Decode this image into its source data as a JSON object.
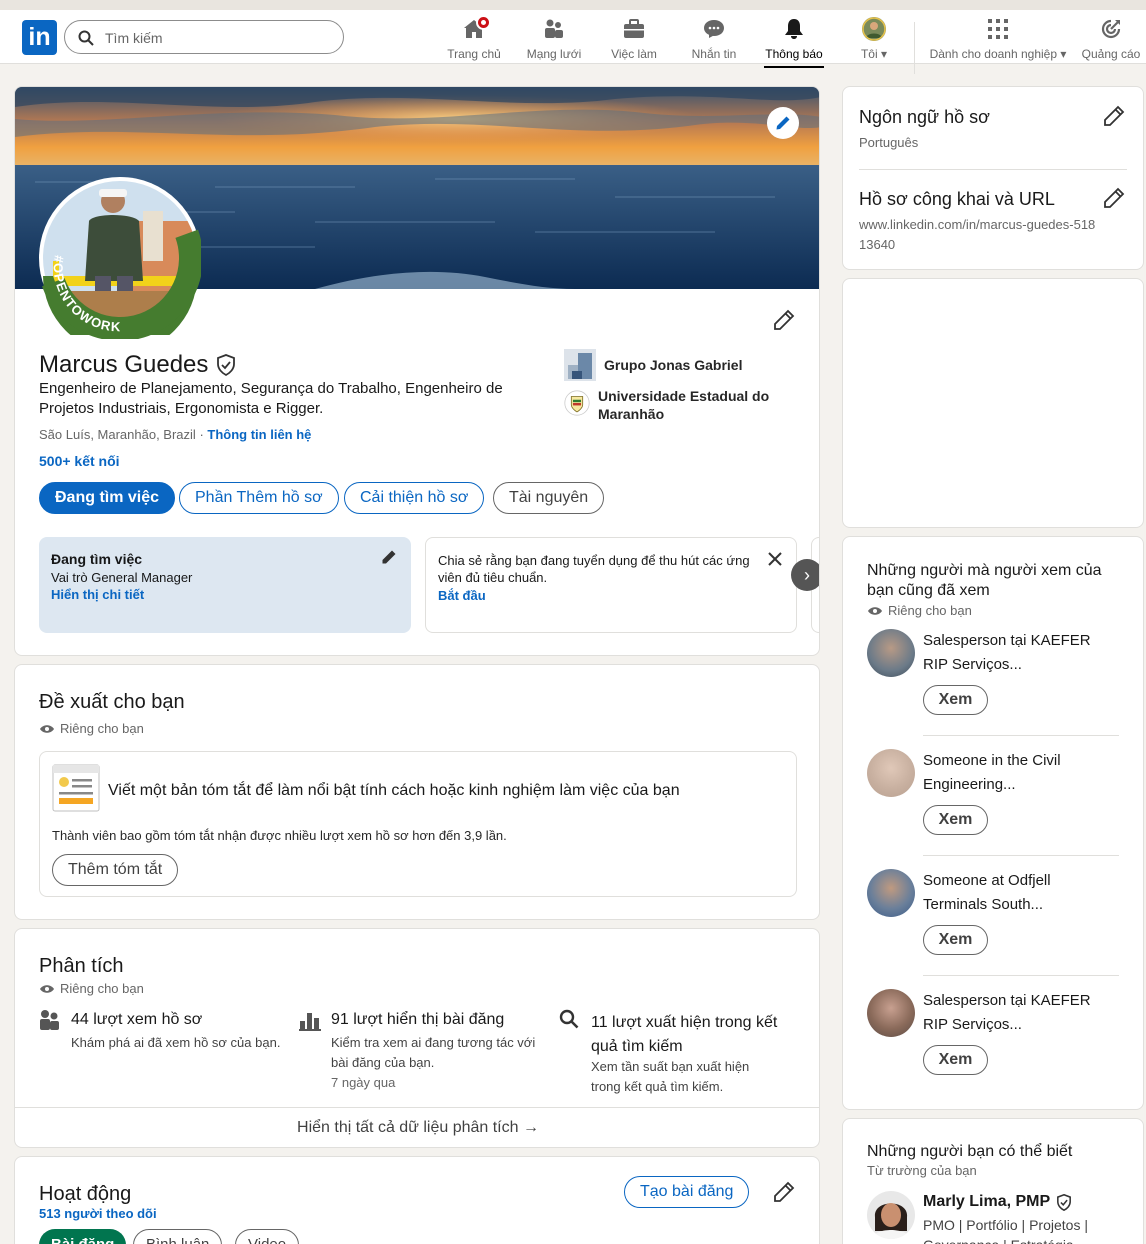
{
  "nav": {
    "logo_text": "in",
    "search_placeholder": "Tìm kiếm",
    "items": [
      {
        "label": "Trang chủ",
        "icon": "home-icon"
      },
      {
        "label": "Mạng lưới",
        "icon": "network-icon"
      },
      {
        "label": "Việc làm",
        "icon": "briefcase-icon"
      },
      {
        "label": "Nhắn tin",
        "icon": "messaging-icon"
      },
      {
        "label": "Thông báo",
        "icon": "bell-icon"
      },
      {
        "label": "Tôi",
        "icon": "avatar"
      },
      {
        "label": "Dành cho doanh nghiệp",
        "icon": "grid-icon"
      },
      {
        "label": "Quảng cáo",
        "icon": "advertise-icon"
      }
    ],
    "accent": "#0a66c2",
    "badge_color": "#cc1016"
  },
  "profile": {
    "name": "Marcus Guedes",
    "headline": "Engenheiro de Planejamento, Segurança do Trabalho, Engenheiro de Projetos Industriais, Ergonomista e Rigger.",
    "location": "São Luís, Maranhão, Brazil",
    "location_sep": "·",
    "contact_link": "Thông tin liên hệ",
    "connections": "500+ kết nối",
    "open_badge": "#OPENTOWORK",
    "experience": [
      {
        "name": "Grupo Jonas Gabriel"
      },
      {
        "name": "Universidade Estadual do Maranhão"
      }
    ],
    "buttons": {
      "open_to": "Đang tìm việc",
      "add_section": "Phần Thêm hồ sơ",
      "enhance": "Cải thiện hồ sơ",
      "resources": "Tài nguyên"
    },
    "open_to_work_card": {
      "title": "Đang tìm việc",
      "role": "Vai trò General Manager",
      "link": "Hiển thị chi tiết"
    },
    "hiring_card": {
      "text": "Chia sẻ rằng bạn đang tuyển dụng để thu hút các ứng viên đủ tiêu chuẩn.",
      "link": "Bắt đầu"
    }
  },
  "suggested": {
    "title": "Đề xuất cho bạn",
    "private": "Riêng cho bạn",
    "item_title": "Viết một bản tóm tắt để làm nổi bật tính cách hoặc kinh nghiệm làm việc của bạn",
    "item_desc": "Thành viên bao gồm tóm tắt nhận được nhiều lượt xem hồ sơ hơn đến 3,9 lần.",
    "button": "Thêm tóm tắt"
  },
  "analytics": {
    "title": "Phân tích",
    "private": "Riêng cho bạn",
    "items": [
      {
        "title": "44 lượt xem hồ sơ",
        "desc": "Khám phá ai đã xem hồ sơ của bạn.",
        "sub": ""
      },
      {
        "title": "91 lượt hiển thị bài đăng",
        "desc": "Kiểm tra xem ai đang tương tác với bài đăng của bạn.",
        "sub": "7 ngày qua"
      },
      {
        "title": "11 lượt xuất hiện trong kết quả tìm kiếm",
        "desc": "Xem tần suất bạn xuất hiện trong kết quả tìm kiếm.",
        "sub": ""
      }
    ],
    "show_all": "Hiển thị tất cả dữ liệu phân tích →"
  },
  "activity": {
    "title": "Hoạt động",
    "followers": "513 người theo dõi",
    "create_post": "Tạo bài đăng",
    "tabs": [
      "Bài đăng",
      "Bình luận",
      "Video"
    ]
  },
  "sidebar": {
    "profile_language": {
      "title": "Ngôn ngữ hồ sơ",
      "value": "Português"
    },
    "public_profile": {
      "title": "Hồ sơ công khai và URL",
      "value": "www.linkedin.com/in/marcus-guedes-51813640"
    },
    "viewers": {
      "title": "Những người mà người xem của bạn cũng đã xem",
      "private": "Riêng cho bạn",
      "button": "Xem",
      "people": [
        {
          "text": "Salesperson tại KAEFER RIP Serviços..."
        },
        {
          "text": "Someone in the Civil Engineering..."
        },
        {
          "text": "Someone at Odfjell Terminals South..."
        },
        {
          "text": "Salesperson tại KAEFER RIP Serviços..."
        }
      ]
    },
    "pymk": {
      "title": "Những người bạn có thể biết",
      "subtitle": "Từ trường của bạn",
      "person_name": "Marly Lima, PMP",
      "person_headline": "PMO | Portfólio | Projetos | Governança | Estratégia"
    }
  }
}
